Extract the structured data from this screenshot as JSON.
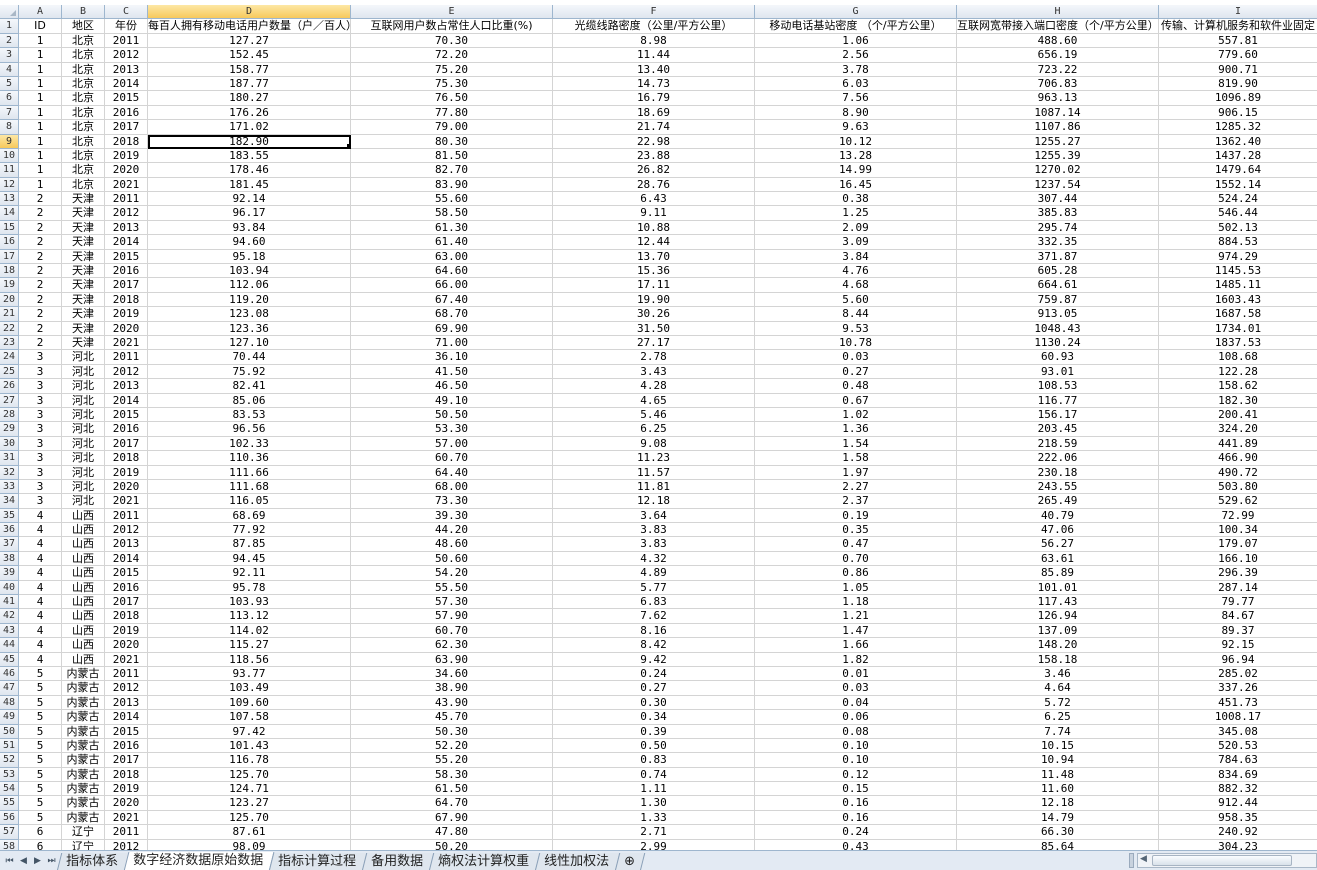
{
  "columns": [
    "A",
    "B",
    "C",
    "D",
    "E",
    "F",
    "G",
    "H",
    "I"
  ],
  "active_column": "D",
  "active_row": "9",
  "header_row": [
    "ID",
    "地区",
    "年份",
    "每百人拥有移动电话用户数量（户／百人）",
    "互联网用户数占常住人口比重(%)",
    "光缆线路密度（公里/平方公里）",
    "移动电话基站密度 （个/平方公里）",
    "互联网宽带接入端口密度（个/平方公里）",
    "传输、计算机服务和软件业固定"
  ],
  "rows": [
    [
      "1",
      "北京",
      "2011",
      "127.27",
      "70.30",
      "8.98",
      "1.06",
      "488.60",
      "557.81"
    ],
    [
      "1",
      "北京",
      "2012",
      "152.45",
      "72.20",
      "11.44",
      "2.56",
      "656.19",
      "779.60"
    ],
    [
      "1",
      "北京",
      "2013",
      "158.77",
      "75.20",
      "13.40",
      "3.78",
      "723.22",
      "900.71"
    ],
    [
      "1",
      "北京",
      "2014",
      "187.77",
      "75.30",
      "14.73",
      "6.03",
      "706.83",
      "819.90"
    ],
    [
      "1",
      "北京",
      "2015",
      "180.27",
      "76.50",
      "16.79",
      "7.56",
      "963.13",
      "1096.89"
    ],
    [
      "1",
      "北京",
      "2016",
      "176.26",
      "77.80",
      "18.69",
      "8.90",
      "1087.14",
      "906.15"
    ],
    [
      "1",
      "北京",
      "2017",
      "171.02",
      "79.00",
      "21.74",
      "9.63",
      "1107.86",
      "1285.32"
    ],
    [
      "1",
      "北京",
      "2018",
      "182.90",
      "80.30",
      "22.98",
      "10.12",
      "1255.27",
      "1362.40"
    ],
    [
      "1",
      "北京",
      "2019",
      "183.55",
      "81.50",
      "23.88",
      "13.28",
      "1255.39",
      "1437.28"
    ],
    [
      "1",
      "北京",
      "2020",
      "178.46",
      "82.70",
      "26.82",
      "14.99",
      "1270.02",
      "1479.64"
    ],
    [
      "1",
      "北京",
      "2021",
      "181.45",
      "83.90",
      "28.76",
      "16.45",
      "1237.54",
      "1552.14"
    ],
    [
      "2",
      "天津",
      "2011",
      "92.14",
      "55.60",
      "6.43",
      "0.38",
      "307.44",
      "524.24"
    ],
    [
      "2",
      "天津",
      "2012",
      "96.17",
      "58.50",
      "9.11",
      "1.25",
      "385.83",
      "546.44"
    ],
    [
      "2",
      "天津",
      "2013",
      "93.84",
      "61.30",
      "10.88",
      "2.09",
      "295.74",
      "502.13"
    ],
    [
      "2",
      "天津",
      "2014",
      "94.60",
      "61.40",
      "12.44",
      "3.09",
      "332.35",
      "884.53"
    ],
    [
      "2",
      "天津",
      "2015",
      "95.18",
      "63.00",
      "13.70",
      "3.84",
      "371.87",
      "974.29"
    ],
    [
      "2",
      "天津",
      "2016",
      "103.94",
      "64.60",
      "15.36",
      "4.76",
      "605.28",
      "1145.53"
    ],
    [
      "2",
      "天津",
      "2017",
      "112.06",
      "66.00",
      "17.11",
      "4.68",
      "664.61",
      "1485.11"
    ],
    [
      "2",
      "天津",
      "2018",
      "119.20",
      "67.40",
      "19.90",
      "5.60",
      "759.87",
      "1603.43"
    ],
    [
      "2",
      "天津",
      "2019",
      "123.08",
      "68.70",
      "30.26",
      "8.44",
      "913.05",
      "1687.58"
    ],
    [
      "2",
      "天津",
      "2020",
      "123.36",
      "69.90",
      "31.50",
      "9.53",
      "1048.43",
      "1734.01"
    ],
    [
      "2",
      "天津",
      "2021",
      "127.10",
      "71.00",
      "27.17",
      "10.78",
      "1130.24",
      "1837.53"
    ],
    [
      "3",
      "河北",
      "2011",
      "70.44",
      "36.10",
      "2.78",
      "0.03",
      "60.93",
      "108.68"
    ],
    [
      "3",
      "河北",
      "2012",
      "75.92",
      "41.50",
      "3.43",
      "0.27",
      "93.01",
      "122.28"
    ],
    [
      "3",
      "河北",
      "2013",
      "82.41",
      "46.50",
      "4.28",
      "0.48",
      "108.53",
      "158.62"
    ],
    [
      "3",
      "河北",
      "2014",
      "85.06",
      "49.10",
      "4.65",
      "0.67",
      "116.77",
      "182.30"
    ],
    [
      "3",
      "河北",
      "2015",
      "83.53",
      "50.50",
      "5.46",
      "1.02",
      "156.17",
      "200.41"
    ],
    [
      "3",
      "河北",
      "2016",
      "96.56",
      "53.30",
      "6.25",
      "1.36",
      "203.45",
      "324.20"
    ],
    [
      "3",
      "河北",
      "2017",
      "102.33",
      "57.00",
      "9.08",
      "1.54",
      "218.59",
      "441.89"
    ],
    [
      "3",
      "河北",
      "2018",
      "110.36",
      "60.70",
      "11.23",
      "1.58",
      "222.06",
      "466.90"
    ],
    [
      "3",
      "河北",
      "2019",
      "111.66",
      "64.40",
      "11.57",
      "1.97",
      "230.18",
      "490.72"
    ],
    [
      "3",
      "河北",
      "2020",
      "111.68",
      "68.00",
      "11.81",
      "2.27",
      "243.55",
      "503.80"
    ],
    [
      "3",
      "河北",
      "2021",
      "116.05",
      "73.30",
      "12.18",
      "2.37",
      "265.49",
      "529.62"
    ],
    [
      "4",
      "山西",
      "2011",
      "68.69",
      "39.30",
      "3.64",
      "0.19",
      "40.79",
      "72.99"
    ],
    [
      "4",
      "山西",
      "2012",
      "77.92",
      "44.20",
      "3.83",
      "0.35",
      "47.06",
      "100.34"
    ],
    [
      "4",
      "山西",
      "2013",
      "87.85",
      "48.60",
      "3.83",
      "0.47",
      "56.27",
      "179.07"
    ],
    [
      "4",
      "山西",
      "2014",
      "94.45",
      "50.60",
      "4.32",
      "0.70",
      "63.61",
      "166.10"
    ],
    [
      "4",
      "山西",
      "2015",
      "92.11",
      "54.20",
      "4.89",
      "0.86",
      "85.89",
      "296.39"
    ],
    [
      "4",
      "山西",
      "2016",
      "95.78",
      "55.50",
      "5.77",
      "1.05",
      "101.01",
      "287.14"
    ],
    [
      "4",
      "山西",
      "2017",
      "103.93",
      "57.30",
      "6.83",
      "1.18",
      "117.43",
      "79.77"
    ],
    [
      "4",
      "山西",
      "2018",
      "113.12",
      "57.90",
      "7.62",
      "1.21",
      "126.94",
      "84.67"
    ],
    [
      "4",
      "山西",
      "2019",
      "114.02",
      "60.70",
      "8.16",
      "1.47",
      "137.09",
      "89.37"
    ],
    [
      "4",
      "山西",
      "2020",
      "115.27",
      "62.30",
      "8.42",
      "1.66",
      "148.20",
      "92.15"
    ],
    [
      "4",
      "山西",
      "2021",
      "118.56",
      "63.90",
      "9.42",
      "1.82",
      "158.18",
      "96.94"
    ],
    [
      "5",
      "内蒙古",
      "2011",
      "93.77",
      "34.60",
      "0.24",
      "0.01",
      "3.46",
      "285.02"
    ],
    [
      "5",
      "内蒙古",
      "2012",
      "103.49",
      "38.90",
      "0.27",
      "0.03",
      "4.64",
      "337.26"
    ],
    [
      "5",
      "内蒙古",
      "2013",
      "109.60",
      "43.90",
      "0.30",
      "0.04",
      "5.72",
      "451.73"
    ],
    [
      "5",
      "内蒙古",
      "2014",
      "107.58",
      "45.70",
      "0.34",
      "0.06",
      "6.25",
      "1008.17"
    ],
    [
      "5",
      "内蒙古",
      "2015",
      "97.42",
      "50.30",
      "0.39",
      "0.08",
      "7.74",
      "345.08"
    ],
    [
      "5",
      "内蒙古",
      "2016",
      "101.43",
      "52.20",
      "0.50",
      "0.10",
      "10.15",
      "520.53"
    ],
    [
      "5",
      "内蒙古",
      "2017",
      "116.78",
      "55.20",
      "0.83",
      "0.10",
      "10.94",
      "784.63"
    ],
    [
      "5",
      "内蒙古",
      "2018",
      "125.70",
      "58.30",
      "0.74",
      "0.12",
      "11.48",
      "834.69"
    ],
    [
      "5",
      "内蒙古",
      "2019",
      "124.71",
      "61.50",
      "1.11",
      "0.15",
      "11.60",
      "882.32"
    ],
    [
      "5",
      "内蒙古",
      "2020",
      "123.27",
      "64.70",
      "1.30",
      "0.16",
      "12.18",
      "912.44"
    ],
    [
      "5",
      "内蒙古",
      "2021",
      "125.70",
      "67.90",
      "1.33",
      "0.16",
      "14.79",
      "958.35"
    ],
    [
      "6",
      "辽宁",
      "2011",
      "87.61",
      "47.80",
      "2.71",
      "0.24",
      "66.30",
      "240.92"
    ],
    [
      "6",
      "辽宁",
      "2012",
      "98.09",
      "50.20",
      "2.99",
      "0.43",
      "85.64",
      "304.23"
    ]
  ],
  "tabs": [
    "指标体系",
    "数字经济数据原始数据",
    "指标计算过程",
    "备用数据",
    "熵权法计算权重",
    "线性加权法"
  ],
  "active_tab": 1,
  "nav_buttons": [
    "⏮",
    "◀",
    "▶",
    "⏭"
  ]
}
